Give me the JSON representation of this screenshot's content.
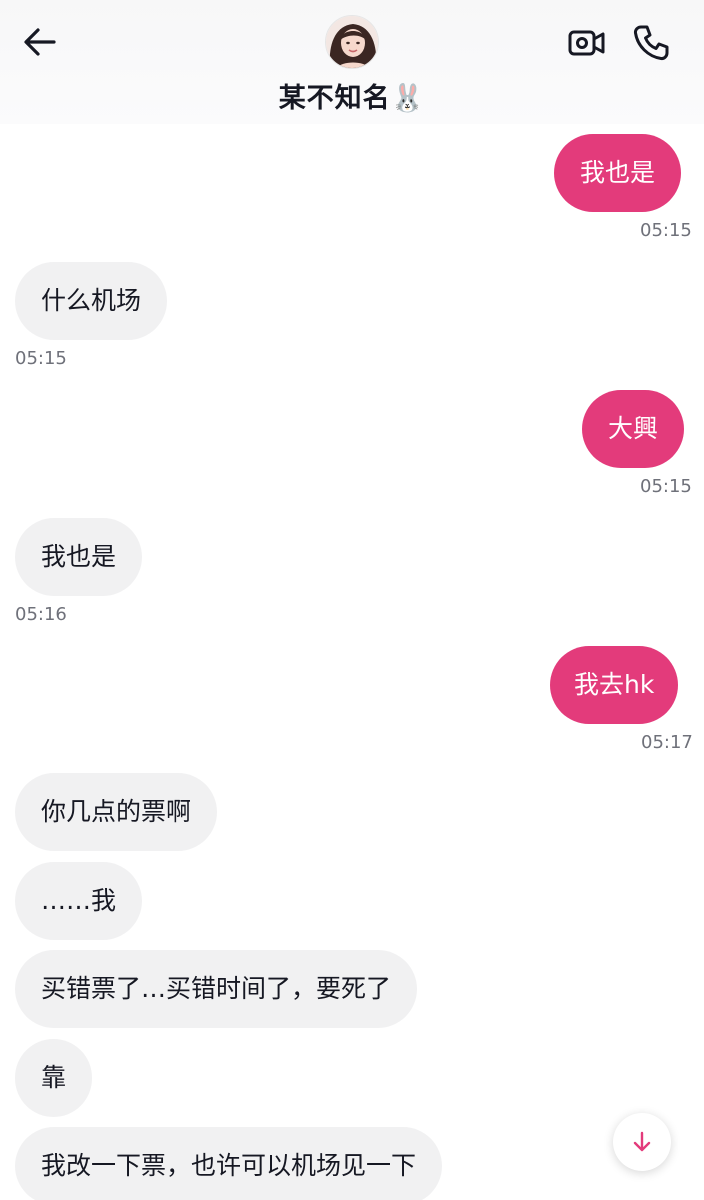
{
  "header": {
    "title": "某不知名",
    "title_emoji": "🐰",
    "back_icon": "arrow-left-icon",
    "video_icon": "video-camera-icon",
    "call_icon": "phone-icon"
  },
  "messages": [
    {
      "sender": "me",
      "text": "我也是",
      "time": "05:15"
    },
    {
      "sender": "them",
      "text": "什么机场",
      "time": "05:15"
    },
    {
      "sender": "me",
      "text": "大興",
      "time": "05:15"
    },
    {
      "sender": "them",
      "text": "我也是",
      "time": "05:16"
    },
    {
      "sender": "me",
      "text": "我去hk",
      "time": "05:17"
    },
    {
      "sender": "them",
      "text": "你几点的票啊"
    },
    {
      "sender": "them",
      "text": "……我"
    },
    {
      "sender": "them",
      "text": "买错票了…买错时间了，要死了"
    },
    {
      "sender": "them",
      "text": "靠"
    },
    {
      "sender": "them",
      "text": "我改一下票，也许可以机场见一下"
    }
  ],
  "colors": {
    "outgoing_bubble": "#e33b7b",
    "incoming_bubble": "#f1f1f2",
    "accent": "#e33b7b"
  },
  "scroll_button_icon": "arrow-down-icon"
}
